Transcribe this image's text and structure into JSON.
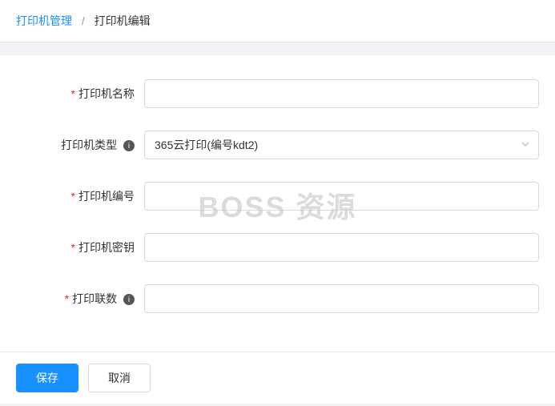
{
  "breadcrumb": {
    "parent": "打印机管理",
    "separator": "/",
    "current": "打印机编辑"
  },
  "form": {
    "fields": {
      "name": {
        "label": "打印机名称",
        "value": "",
        "required": true
      },
      "type": {
        "label": "打印机类型",
        "value": "365云打印(编号kdt2)",
        "required": false,
        "has_info": true
      },
      "number": {
        "label": "打印机编号",
        "value": "",
        "required": true
      },
      "secret": {
        "label": "打印机密钥",
        "value": "",
        "required": true
      },
      "copies": {
        "label": "打印联数",
        "value": "",
        "required": true,
        "has_info": true
      }
    }
  },
  "buttons": {
    "save": "保存",
    "cancel": "取消"
  },
  "watermark": "BOSS 资源",
  "required_mark": "*",
  "info_mark": "i"
}
